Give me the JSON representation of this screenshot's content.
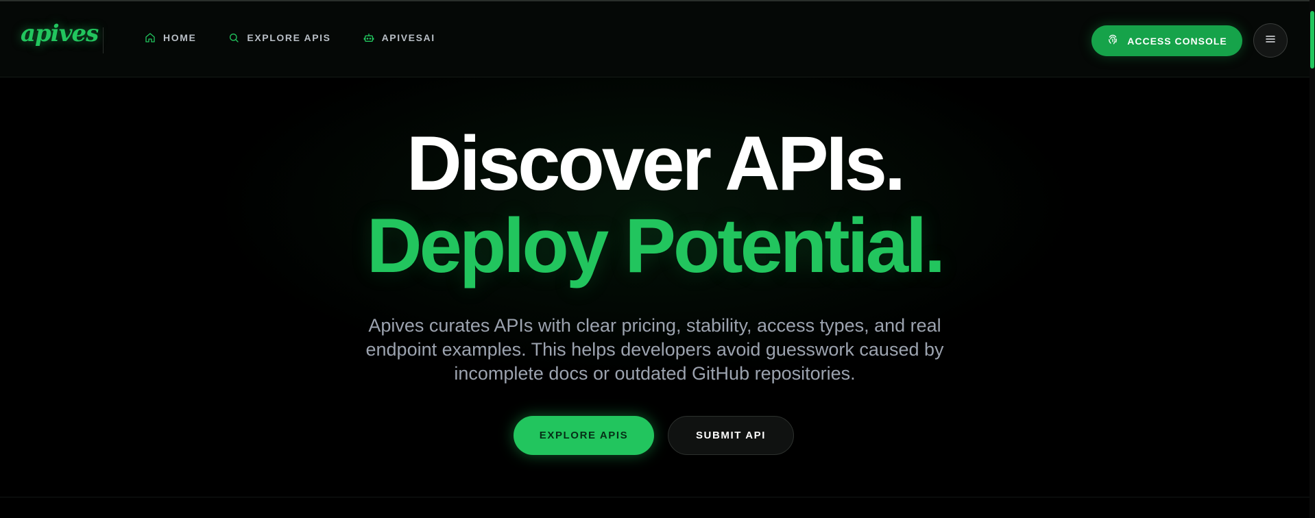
{
  "brand": {
    "logo_text": "apives",
    "accent_color": "#22c55e"
  },
  "nav": {
    "items": [
      {
        "label": "HOME",
        "icon": "home-icon"
      },
      {
        "label": "EXPLORE APIS",
        "icon": "search-icon"
      },
      {
        "label": "APIVESAI",
        "icon": "bot-icon"
      }
    ]
  },
  "header": {
    "console_button": {
      "label": "ACCESS CONSOLE",
      "icon": "fingerprint-icon"
    },
    "menu_button": {
      "icon": "hamburger-icon"
    }
  },
  "hero": {
    "title_line1": "Discover APIs.",
    "title_line2": "Deploy Potential.",
    "description": "Apives curates APIs with clear pricing, stability, access types, and real endpoint examples. This helps developers avoid guesswork caused by incomplete docs or outdated GitHub repositories.",
    "primary_cta": "EXPLORE APIS",
    "secondary_cta": "SUBMIT API"
  }
}
